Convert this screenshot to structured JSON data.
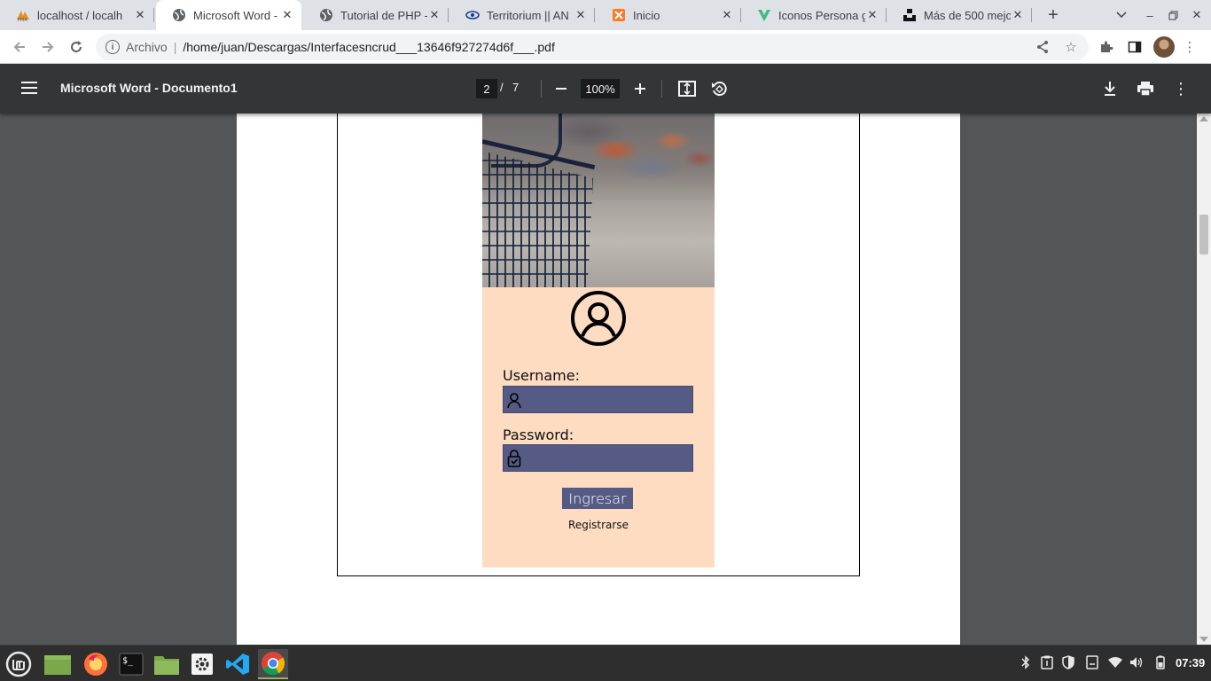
{
  "tabs": [
    {
      "title": "localhost / localh",
      "icon": "phpmyadmin-icon",
      "active": false
    },
    {
      "title": "Microsoft Word -",
      "icon": "globe-icon",
      "active": true
    },
    {
      "title": "Tutorial de PHP -",
      "icon": "globe-icon",
      "active": false
    },
    {
      "title": "Territorium || AN",
      "icon": "eye-icon",
      "active": false
    },
    {
      "title": "Inicio",
      "icon": "xampp-icon",
      "active": false
    },
    {
      "title": "Iconos Persona g",
      "icon": "vuetify-icon",
      "active": false
    },
    {
      "title": "Más de 500 mejo",
      "icon": "unsplash-icon",
      "active": false
    }
  ],
  "address_bar": {
    "scheme_label": "Archivo",
    "url": "/home/juan/Descargas/Interfacesncrud___13646f927274d6f___.pdf"
  },
  "pdf_viewer": {
    "title": "Microsoft Word - Documento1",
    "current_page": "2",
    "page_separator": "/",
    "total_pages": "7",
    "zoom": "100%"
  },
  "login_form": {
    "username_label": "Username:",
    "password_label": "Password:",
    "username_value": "",
    "password_value": "",
    "submit_label": "Ingresar",
    "register_label": "Registrarse",
    "accent_color": "#555b84",
    "background_color": "#fddcc1"
  },
  "taskbar": {
    "apps": [
      "mint-menu-icon",
      "show-desktop-icon",
      "firefox-icon",
      "terminal-icon",
      "files-icon",
      "settings-icon",
      "vscode-icon",
      "chrome-icon"
    ],
    "tray": [
      "bluetooth-icon",
      "clipboard-icon",
      "shield-icon",
      "notes-icon",
      "wifi-icon",
      "volume-icon",
      "battery-icon"
    ],
    "time": "07:39"
  }
}
